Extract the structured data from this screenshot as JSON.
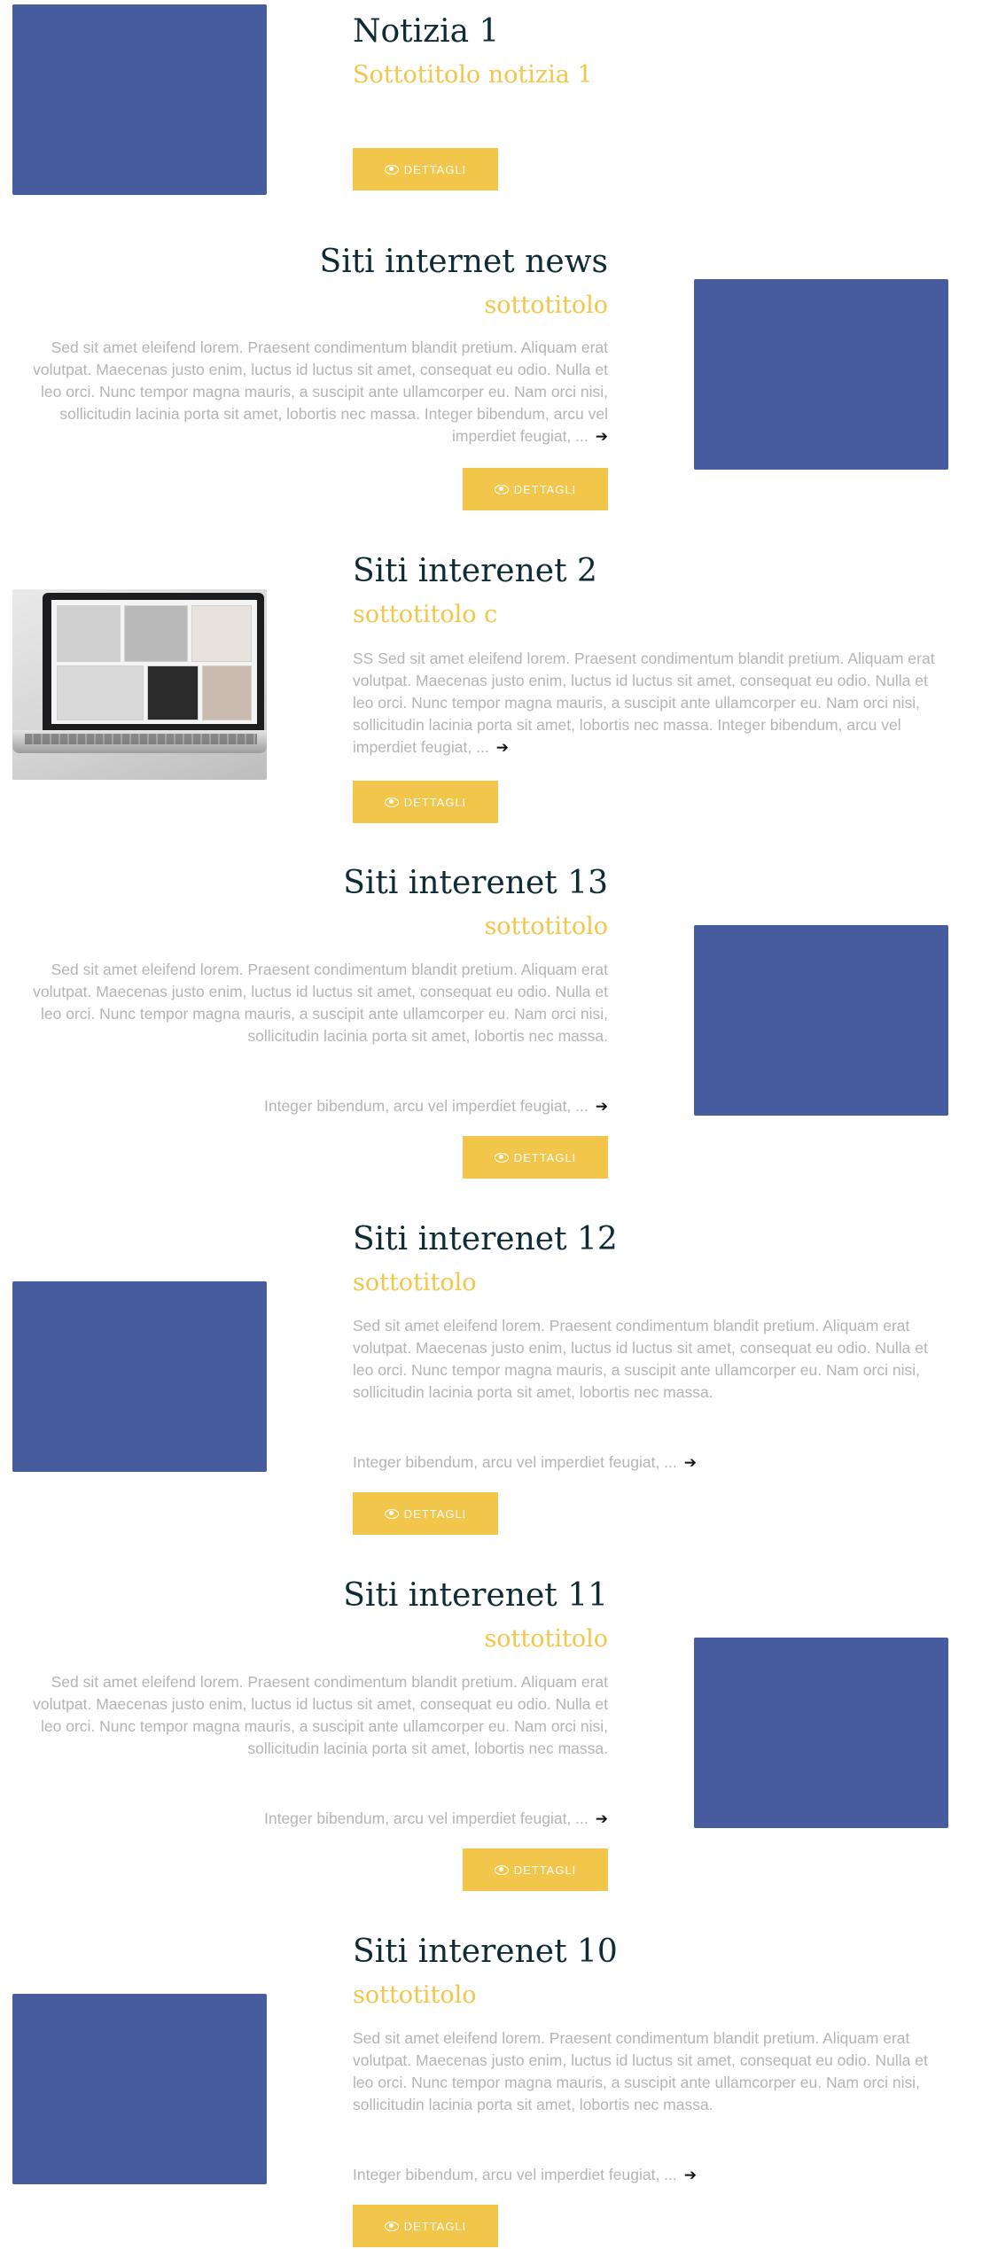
{
  "colors": {
    "thumbnail": "#465c9e",
    "accent": "#f2c64a",
    "title": "#0f2b33",
    "text": "#b4b4b4"
  },
  "button_label": "DETTAGLI",
  "arrow_icon": "right-arrow-icon",
  "button_icon": "eye-icon",
  "articles": [
    {
      "title": "Notizia 1",
      "subtitle": "Sottotitolo notizia 1",
      "image": "placeholder"
    },
    {
      "title": "Siti internet news",
      "subtitle": "sottotitolo",
      "excerpt": "Sed sit amet eleifend lorem. Praesent condimentum blandit pretium. Aliquam erat volutpat. Maecenas justo enim, luctus id luctus sit amet, consequat eu odio. Nulla et leo orci. Nunc tempor magna mauris, a suscipit ante ullamcorper eu. Nam orci nisi, sollicitudin lacinia porta sit amet, lobortis nec massa. Integer bibendum, arcu vel imperdiet feugiat, ...",
      "image": "placeholder"
    },
    {
      "title": "Siti interenet 2",
      "subtitle": "sottotitolo c",
      "excerpt": "SS Sed sit amet eleifend lorem. Praesent condimentum blandit pretium. Aliquam erat volutpat. Maecenas justo enim, luctus id luctus sit amet, consequat eu odio. Nulla et leo orci. Nunc tempor magna mauris, a suscipit ante ullamcorper eu. Nam orci nisi, sollicitudin lacinia porta sit amet, lobortis nec massa. Integer bibendum, arcu vel imperdiet feugiat, ...",
      "image": "laptop-photo"
    },
    {
      "title": "Siti interenet 13",
      "subtitle": "sottotitolo",
      "excerpt": "Sed sit amet eleifend lorem. Praesent condimentum blandit pretium. Aliquam erat volutpat. Maecenas justo enim, luctus id luctus sit amet, consequat eu odio. Nulla et leo orci. Nunc tempor magna mauris, a suscipit ante ullamcorper eu. Nam orci nisi, sollicitudin lacinia porta sit amet, lobortis nec massa.",
      "tail": "Integer bibendum, arcu vel imperdiet feugiat, ...",
      "image": "placeholder"
    },
    {
      "title": "Siti interenet 12",
      "subtitle": "sottotitolo",
      "excerpt": "Sed sit amet eleifend lorem. Praesent condimentum blandit pretium. Aliquam erat volutpat. Maecenas justo enim, luctus id luctus sit amet, consequat eu odio. Nulla et leo orci. Nunc tempor magna mauris, a suscipit ante ullamcorper eu. Nam orci nisi, sollicitudin lacinia porta sit amet, lobortis nec massa.",
      "tail": "Integer bibendum, arcu vel imperdiet feugiat, ...",
      "image": "placeholder"
    },
    {
      "title": "Siti interenet 11",
      "subtitle": "sottotitolo",
      "excerpt": "Sed sit amet eleifend lorem. Praesent condimentum blandit pretium. Aliquam erat volutpat. Maecenas justo enim, luctus id luctus sit amet, consequat eu odio. Nulla et leo orci. Nunc tempor magna mauris, a suscipit ante ullamcorper eu. Nam orci nisi, sollicitudin lacinia porta sit amet, lobortis nec massa.",
      "tail": "Integer bibendum, arcu vel imperdiet feugiat, ...",
      "image": "placeholder"
    },
    {
      "title": "Siti interenet 10",
      "subtitle": "sottotitolo",
      "excerpt": "Sed sit amet eleifend lorem. Praesent condimentum blandit pretium. Aliquam erat volutpat. Maecenas justo enim, luctus id luctus sit amet, consequat eu odio. Nulla et leo orci. Nunc tempor magna mauris, a suscipit ante ullamcorper eu. Nam orci nisi, sollicitudin lacinia porta sit amet, lobortis nec massa.",
      "tail": "Integer bibendum, arcu vel imperdiet feugiat, ...",
      "image": "placeholder"
    }
  ]
}
